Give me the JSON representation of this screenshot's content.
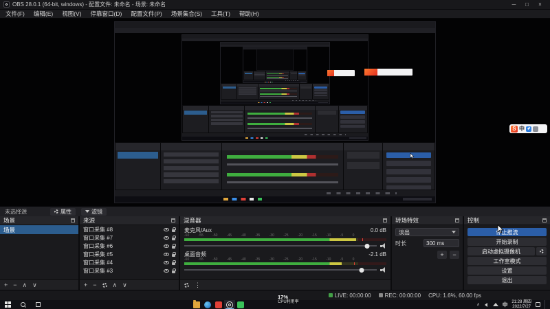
{
  "window": {
    "title": "OBS 28.0.1 (64-bit, windows) - 配置文件: 未命名 - 场景: 未命名",
    "controls": {
      "minimize": "─",
      "maximize": "□",
      "close": "×"
    }
  },
  "menu": {
    "items": [
      "文件(F)",
      "编辑(E)",
      "视图(V)",
      "停靠窗口(D)",
      "配置文件(P)",
      "场景集合(S)",
      "工具(T)",
      "帮助(H)"
    ]
  },
  "selection_bar": {
    "message": "未选择源",
    "properties": "属性",
    "filters": "滤镜"
  },
  "dock_toolbar": {
    "add": "+",
    "remove": "−",
    "up": "∧",
    "down": "∨",
    "more": "⋮"
  },
  "scenes": {
    "title": "场景",
    "items": [
      {
        "label": "场景"
      }
    ]
  },
  "sources": {
    "title": "来源",
    "items": [
      "窗口采集 #8",
      "窗口采集 #7",
      "窗口采集 #6",
      "窗口采集 #5",
      "窗口采集 #4",
      "窗口采集 #3"
    ]
  },
  "mixer": {
    "title": "混音器",
    "scale": "-60 -55 -50 -45 -40 -35 -30 -25 -20 -15 -10 -5 0",
    "channels": [
      {
        "name": "麦克风/Aux",
        "db": "0.0 dB",
        "meter_dim_width": "15%",
        "slider_pos": "95%"
      },
      {
        "name": "桌面音频",
        "db": "-2.1 dB",
        "meter_dim_width": "22%",
        "slider_pos": "92%"
      }
    ]
  },
  "transitions": {
    "title": "转场特效",
    "selected": "淡出",
    "duration_label": "时长",
    "duration_value": "300 ms"
  },
  "controls": {
    "title": "控制",
    "stop_streaming": "停止推流",
    "start_recording": "开始录制",
    "virtual_camera": "启动虚拟摄像机",
    "studio_mode": "工作室模式",
    "settings": "设置",
    "exit": "退出"
  },
  "status": {
    "live_label": "LIVE: 00:00:00",
    "rec_label": "REC: 00:00:00",
    "cpu_label": "CPU: 1.6%, 60.00 fps"
  },
  "taskbar": {
    "ime_indicator": "中",
    "clock_time": "21:28 周四",
    "clock_date": "2022/7/27"
  },
  "performance_overlay": {
    "value": "17%",
    "label": "CPU利用率"
  },
  "ime_toolbar": {
    "logo": "S",
    "mode": "中"
  },
  "accent_colors": {
    "selection": "#2c5d8e",
    "primary_button": "#2b5ea8",
    "meter_green": "#3fae3f",
    "live_green": "#43a047"
  }
}
